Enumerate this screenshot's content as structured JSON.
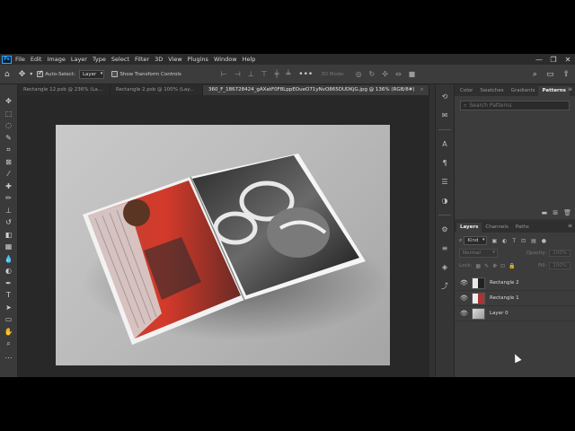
{
  "app": {
    "logo": "Ps"
  },
  "menu": [
    "File",
    "Edit",
    "Image",
    "Layer",
    "Type",
    "Select",
    "Filter",
    "3D",
    "View",
    "Plugins",
    "Window",
    "Help"
  ],
  "window_controls": {
    "minimize": "—",
    "maximize": "❐",
    "close": "✕"
  },
  "options": {
    "auto_select_label": "Auto-Select:",
    "auto_select_value": "Layer",
    "show_transform_label": "Show Transform Controls",
    "three_d_mode_label": "3D Mode:",
    "more": "•••"
  },
  "tabs": [
    {
      "label": "Rectangle 12.psb @ 236% (La...",
      "active": false,
      "close": "×"
    },
    {
      "label": "Rectangle 2.psb @ 100% (Lay...",
      "active": false,
      "close": "×"
    },
    {
      "label": "360_F_186728424_gAXatF0F8LppEOueO71yNvO865DUDKjG.jpg @ 136% (RGB/8#)",
      "active": true,
      "close": "×"
    }
  ],
  "tools": [
    {
      "name": "move-tool",
      "icon": "✥"
    },
    {
      "name": "marquee-tool",
      "icon": "⬚"
    },
    {
      "name": "lasso-tool",
      "icon": "◌"
    },
    {
      "name": "quick-select-tool",
      "icon": "✎"
    },
    {
      "name": "crop-tool",
      "icon": "⌗"
    },
    {
      "name": "frame-tool",
      "icon": "⊠"
    },
    {
      "name": "eyedropper-tool",
      "icon": "⁄"
    },
    {
      "name": "healing-tool",
      "icon": "✚"
    },
    {
      "name": "brush-tool",
      "icon": "✏"
    },
    {
      "name": "clone-stamp-tool",
      "icon": "⊥"
    },
    {
      "name": "history-brush-tool",
      "icon": "↺"
    },
    {
      "name": "eraser-tool",
      "icon": "◧"
    },
    {
      "name": "gradient-tool",
      "icon": "▦"
    },
    {
      "name": "blur-tool",
      "icon": "💧"
    },
    {
      "name": "dodge-tool",
      "icon": "◐"
    },
    {
      "name": "pen-tool",
      "icon": "✒"
    },
    {
      "name": "type-tool",
      "icon": "T"
    },
    {
      "name": "path-select-tool",
      "icon": "➤"
    },
    {
      "name": "shape-tool",
      "icon": "▭"
    },
    {
      "name": "hand-tool",
      "icon": "✋"
    },
    {
      "name": "zoom-tool",
      "icon": "⌕"
    },
    {
      "name": "more-tools",
      "icon": "…"
    }
  ],
  "dock": [
    {
      "name": "history-icon",
      "icon": "⟲"
    },
    {
      "name": "comments-icon",
      "icon": "✉"
    },
    {
      "name": "character-icon",
      "icon": "A"
    },
    {
      "name": "paragraph-icon",
      "icon": "¶"
    },
    {
      "name": "libraries-icon",
      "icon": "☰"
    },
    {
      "name": "adjustments-icon",
      "icon": "◑"
    },
    {
      "name": "properties-icon",
      "icon": "⚙"
    },
    {
      "name": "layers-icon",
      "icon": "≡"
    },
    {
      "name": "channels-icon",
      "icon": "◈"
    },
    {
      "name": "paths-icon",
      "icon": "⤴"
    }
  ],
  "patterns_panel": {
    "tabs": [
      "Color",
      "Swatches",
      "Gradients",
      "Patterns"
    ],
    "active_tab": "Patterns",
    "search_placeholder": "Search Patterns"
  },
  "layers_panel": {
    "tabs": [
      "Layers",
      "Channels",
      "Paths"
    ],
    "active_tab": "Layers",
    "kind_label": "Kind",
    "blend_mode": "Normal",
    "opacity_label": "Opacity:",
    "opacity_value": "100%",
    "lock_label": "Lock:",
    "fill_label": "Fill:",
    "fill_value": "100%",
    "layers": [
      {
        "name": "Rectangle 2",
        "thumb": "t1"
      },
      {
        "name": "Rectangle 1",
        "thumb": "t2"
      },
      {
        "name": "Layer 0",
        "thumb": "t3"
      }
    ]
  }
}
